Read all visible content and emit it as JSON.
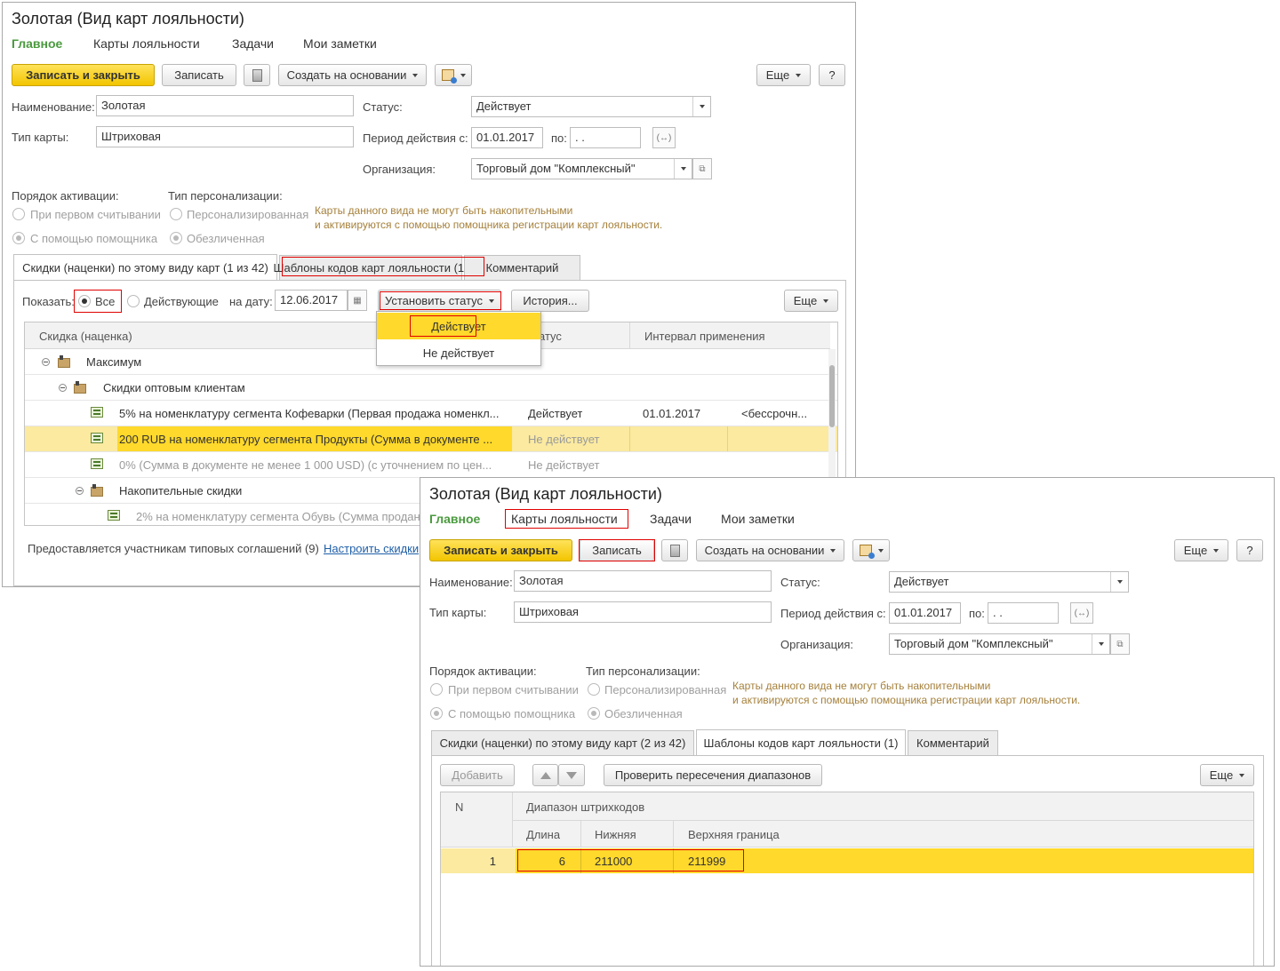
{
  "w1": {
    "title": "Золотая (Вид карт лояльности)",
    "tabs": [
      "Главное",
      "Карты лояльности",
      "Задачи",
      "Мои заметки"
    ],
    "toolbar": {
      "save_close": "Записать и закрыть",
      "save": "Записать",
      "create_based": "Создать на основании",
      "more": "Еще",
      "help": "?"
    },
    "fields": {
      "name_label": "Наименование:",
      "name_value": "Золотая",
      "type_label": "Тип карты:",
      "type_value": "Штриховая",
      "status_label": "Статус:",
      "status_value": "Действует",
      "period_label": "Период действия с:",
      "period_from": "01.01.2017",
      "period_to_label": "по:",
      "period_to": " .  .",
      "org_label": "Организация:",
      "org_value": "Торговый дом \"Комплексный\""
    },
    "activation": {
      "label": "Порядок активации:",
      "opt1": "При первом считывании",
      "opt2": "С помощью помощника"
    },
    "personalization": {
      "label": "Тип персонализации:",
      "opt1": "Персонализированная",
      "opt2": "Обезличенная"
    },
    "note_line1": "Карты данного вида не могут быть накопительными",
    "note_line2": "и активируются с помощью помощника регистрации карт лояльности.",
    "form_tabs": [
      "Скидки (наценки) по этому виду карт (1 из 42)",
      "Шаблоны кодов карт лояльности (1)",
      "Комментарий"
    ],
    "filter": {
      "show_label": "Показать:",
      "all": "Все",
      "active": "Действующие",
      "date_label": "на дату:",
      "date_value": "12.06.2017",
      "set_status": "Установить статус",
      "history": "История...",
      "more": "Еще"
    },
    "grid_headers": [
      "Скидка (наценка)",
      "атус",
      "Интервал применения"
    ],
    "rows": [
      {
        "name": "Максимум"
      },
      {
        "name": "Скидки оптовым клиентам"
      },
      {
        "name": "5% на номенклатуру сегмента Кофеварки (Первая продажа номенкл...",
        "status": "Действует",
        "date": "01.01.2017",
        "end": "<бессрочн..."
      },
      {
        "name": "200 RUB на номенклатуру сегмента Продукты (Сумма в документе ...",
        "status": "Не действует"
      },
      {
        "name": "0% (Сумма в документе не менее 1 000 USD) (с уточнением по цен...",
        "status": "Не действует"
      },
      {
        "name": "Накопительные скидки"
      },
      {
        "name": "2% на номенклатуру сегмента Обувь (Сумма продан"
      }
    ],
    "menu": [
      "Действует",
      "Не действует"
    ],
    "footer_text": "Предоставляется участникам типовых соглашений (9)",
    "footer_link": "Настроить скидки"
  },
  "w2": {
    "title": "Золотая (Вид карт лояльности)",
    "tabs": [
      "Главное",
      "Карты лояльности",
      "Задачи",
      "Мои заметки"
    ],
    "toolbar": {
      "save_close": "Записать и закрыть",
      "save": "Записать",
      "create_based": "Создать на основании",
      "more": "Еще",
      "help": "?"
    },
    "fields": {
      "name_label": "Наименование:",
      "name_value": "Золотая",
      "type_label": "Тип карты:",
      "type_value": "Штриховая",
      "status_label": "Статус:",
      "status_value": "Действует",
      "period_label": "Период действия с:",
      "period_from": "01.01.2017",
      "period_to_label": "по:",
      "period_to": " .  .",
      "org_label": "Организация:",
      "org_value": "Торговый дом \"Комплексный\""
    },
    "activation": {
      "label": "Порядок активации:",
      "opt1": "При первом считывании",
      "opt2": "С помощью помощника"
    },
    "personalization": {
      "label": "Тип персонализации:",
      "opt1": "Персонализированная",
      "opt2": "Обезличенная"
    },
    "note_line1": "Карты данного вида не могут быть накопительными",
    "note_line2": "и активируются с помощью помощника регистрации карт лояльности.",
    "form_tabs": [
      "Скидки (наценки) по этому виду карт (2 из 42)",
      "Шаблоны кодов карт лояльности (1)",
      "Комментарий"
    ],
    "tpl_toolbar": {
      "add": "Добавить",
      "check": "Проверить пересечения диапазонов",
      "more": "Еще"
    },
    "grid": {
      "col_n": "N",
      "group": "Диапазон штрихкодов",
      "col_len": "Длина",
      "col_low": "Нижняя",
      "col_high": "Верхняя граница",
      "row": {
        "n": "1",
        "len": "6",
        "low": "211000",
        "high": "211999"
      }
    }
  }
}
